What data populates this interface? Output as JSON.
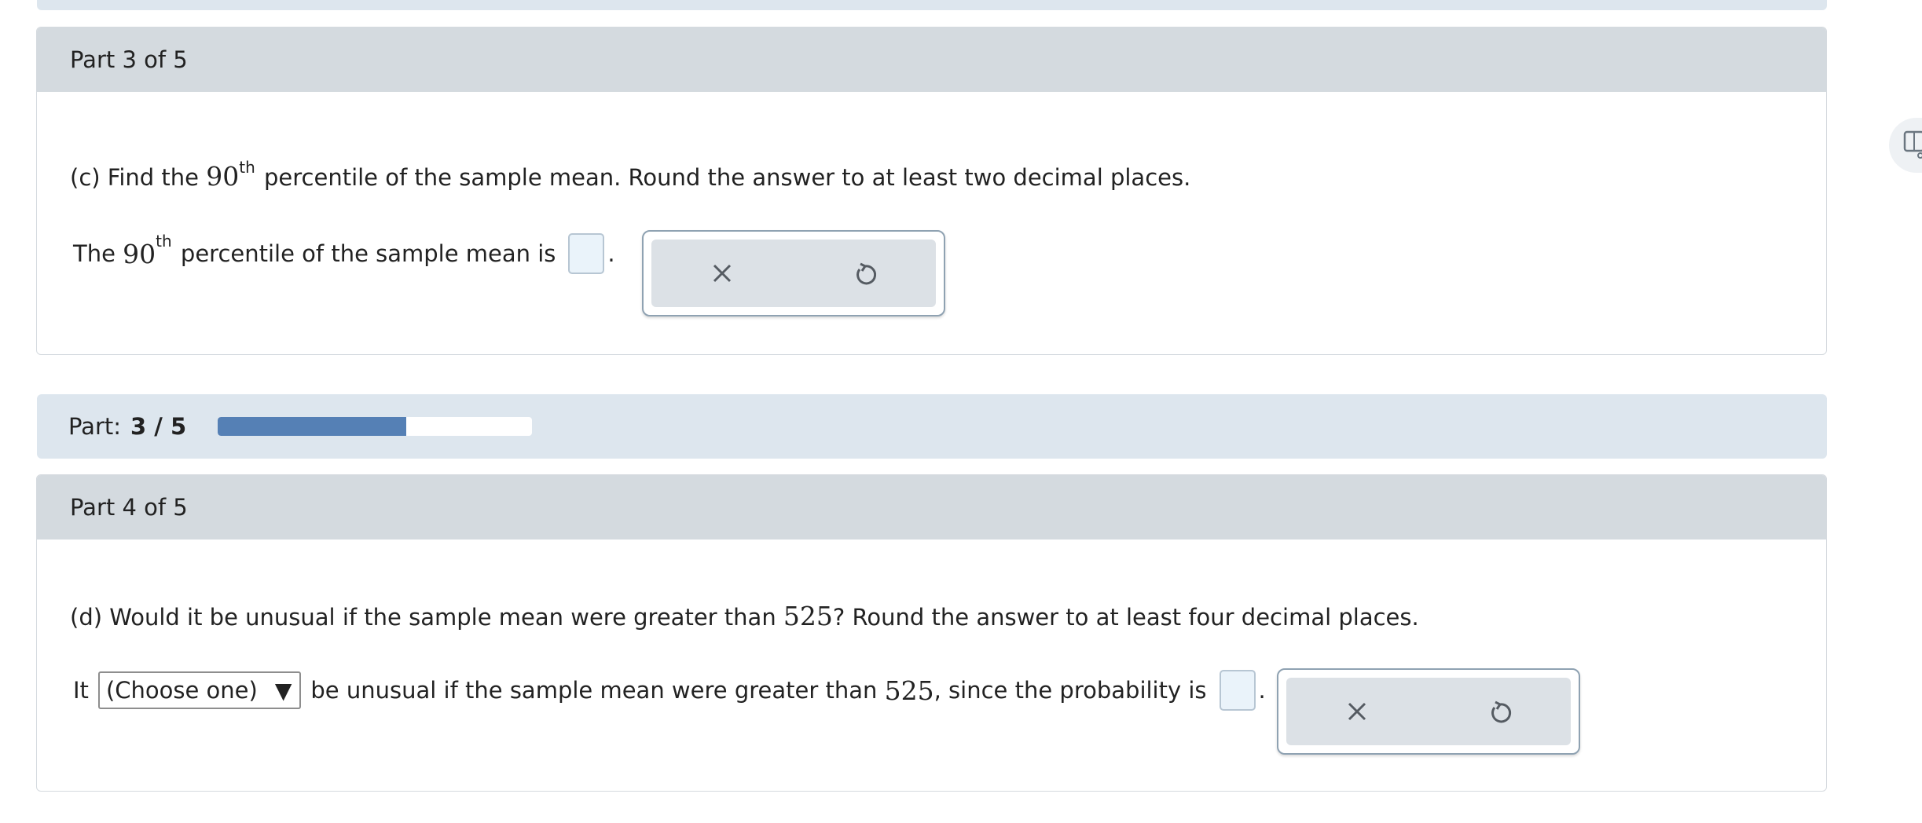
{
  "part3": {
    "header": "Part 3 of 5",
    "question_prefix": "(c) Find the",
    "question_number": "90",
    "question_sup": "th",
    "question_suffix": "percentile of the sample mean. Round the answer to at least two decimal places.",
    "answer_prefix": "The",
    "answer_number": "90",
    "answer_sup": "th",
    "answer_suffix": "percentile of the sample mean is",
    "answer_value": "",
    "period": "."
  },
  "progress": {
    "label": "Part:",
    "value": "3 / 5",
    "fraction": 0.6
  },
  "part4": {
    "header": "Part 4 of 5",
    "question_prefix": "(d) Would it be unusual if the sample mean were greater than",
    "question_number": "525",
    "question_suffix": "? Round the answer to at least four decimal places.",
    "answer_prefix": "It",
    "select_value": "(Choose one)",
    "select_arrow": "▼",
    "answer_middle": "be unusual if the sample mean were greater than",
    "answer_number": "525",
    "answer_suffix": ", since the probability is",
    "answer_value": "",
    "period": "."
  },
  "icons": {
    "clear": "close-icon",
    "undo": "undo-icon",
    "side": "tools-icon"
  },
  "colors": {
    "header_bg": "#d4dadf",
    "progress_bg": "#dde6ee",
    "progress_fill": "#5580b5",
    "answer_box_bg": "#eaf3fa"
  }
}
